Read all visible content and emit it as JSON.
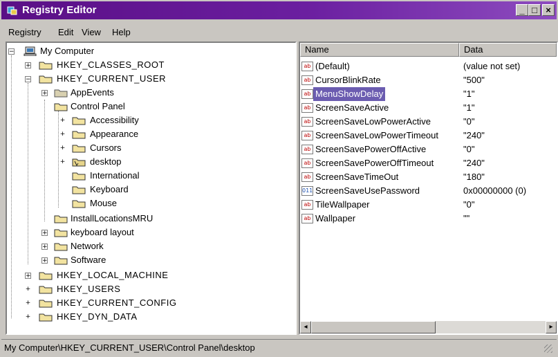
{
  "window": {
    "title": "Registry Editor",
    "min_label": "_",
    "max_label": "□",
    "close_label": "×"
  },
  "menu": [
    {
      "label": "Registry"
    },
    {
      "label": "Edit"
    },
    {
      "label": "View"
    },
    {
      "label": "Help"
    }
  ],
  "tree": {
    "root": "My Computer",
    "classes_root": "HKEY_CLASSES_ROOT",
    "current_user": "HKEY_CURRENT_USER",
    "appevents": "AppEvents",
    "control_panel": "Control Panel",
    "accessibility": "Accessibility",
    "appearance": "Appearance",
    "cursors": "Cursors",
    "desktop": "desktop",
    "international": "International",
    "keyboard": "Keyboard",
    "mouse": "Mouse",
    "installlocations": "InstallLocationsMRU",
    "keyboard_layout": "keyboard layout",
    "network": "Network",
    "software": "Software",
    "local_machine": "HKEY_LOCAL_MACHINE",
    "users": "HKEY_USERS",
    "current_config": "HKEY_CURRENT_CONFIG",
    "dyn_data": "HKEY_DYN_DATA"
  },
  "columns": {
    "name": "Name",
    "data": "Data"
  },
  "values": [
    {
      "name": "(Default)",
      "data": "(value not set)",
      "type": "ab"
    },
    {
      "name": "CursorBlinkRate",
      "data": "\"500\"",
      "type": "ab"
    },
    {
      "name": "MenuShowDelay",
      "data": "\"1\"",
      "type": "ab"
    },
    {
      "name": "ScreenSaveActive",
      "data": "\"1\"",
      "type": "ab"
    },
    {
      "name": "ScreenSaveLowPowerActive",
      "data": "\"0\"",
      "type": "ab"
    },
    {
      "name": "ScreenSaveLowPowerTimeout",
      "data": "\"240\"",
      "type": "ab"
    },
    {
      "name": "ScreenSavePowerOffActive",
      "data": "\"0\"",
      "type": "ab"
    },
    {
      "name": "ScreenSavePowerOffTimeout",
      "data": "\"240\"",
      "type": "ab"
    },
    {
      "name": "ScreenSaveTimeOut",
      "data": "\"180\"",
      "type": "ab"
    },
    {
      "name": "ScreenSaveUsePassword",
      "data": "0x00000000 (0)",
      "type": "bin"
    },
    {
      "name": "TileWallpaper",
      "data": "\"0\"",
      "type": "ab"
    },
    {
      "name": "Wallpaper",
      "data": "\"\"",
      "type": "ab"
    }
  ],
  "selected_value": "MenuShowDelay",
  "status": "My Computer\\HKEY_CURRENT_USER\\Control Panel\\desktop",
  "colors": {
    "titlebar": "#5a0f86",
    "selection": "#6b5cb0",
    "chrome": "#c9c6c1"
  }
}
